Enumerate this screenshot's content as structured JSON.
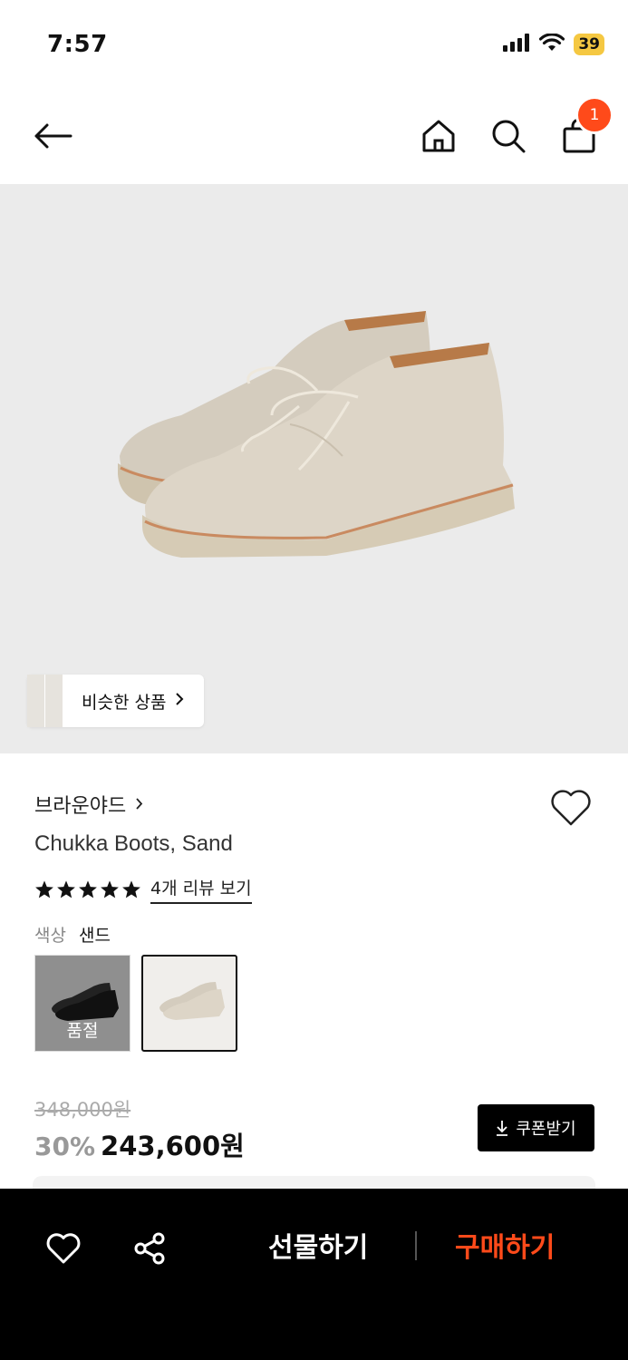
{
  "status_bar": {
    "time": "7:57",
    "battery": "39"
  },
  "nav": {
    "cart_count": "1"
  },
  "similar": {
    "label": "비슷한 상품"
  },
  "product": {
    "brand": "브라운야드",
    "name": "Chukka Boots, Sand",
    "rating_stars": 5,
    "review_link": "4개 리뷰 보기",
    "color_label": "색상",
    "color_value": "샌드",
    "color_options": [
      {
        "name": "black",
        "status": "품절"
      },
      {
        "name": "sand",
        "status": ""
      }
    ],
    "original_price": "348,000원",
    "discount": "30%",
    "sale_price": "243,600원",
    "coupon_label": "쿠폰받기"
  },
  "bottom_bar": {
    "gift_label": "선물하기",
    "buy_label": "구매하기"
  },
  "colors": {
    "accent": "#ff4a1a",
    "battery": "#f5c842"
  }
}
